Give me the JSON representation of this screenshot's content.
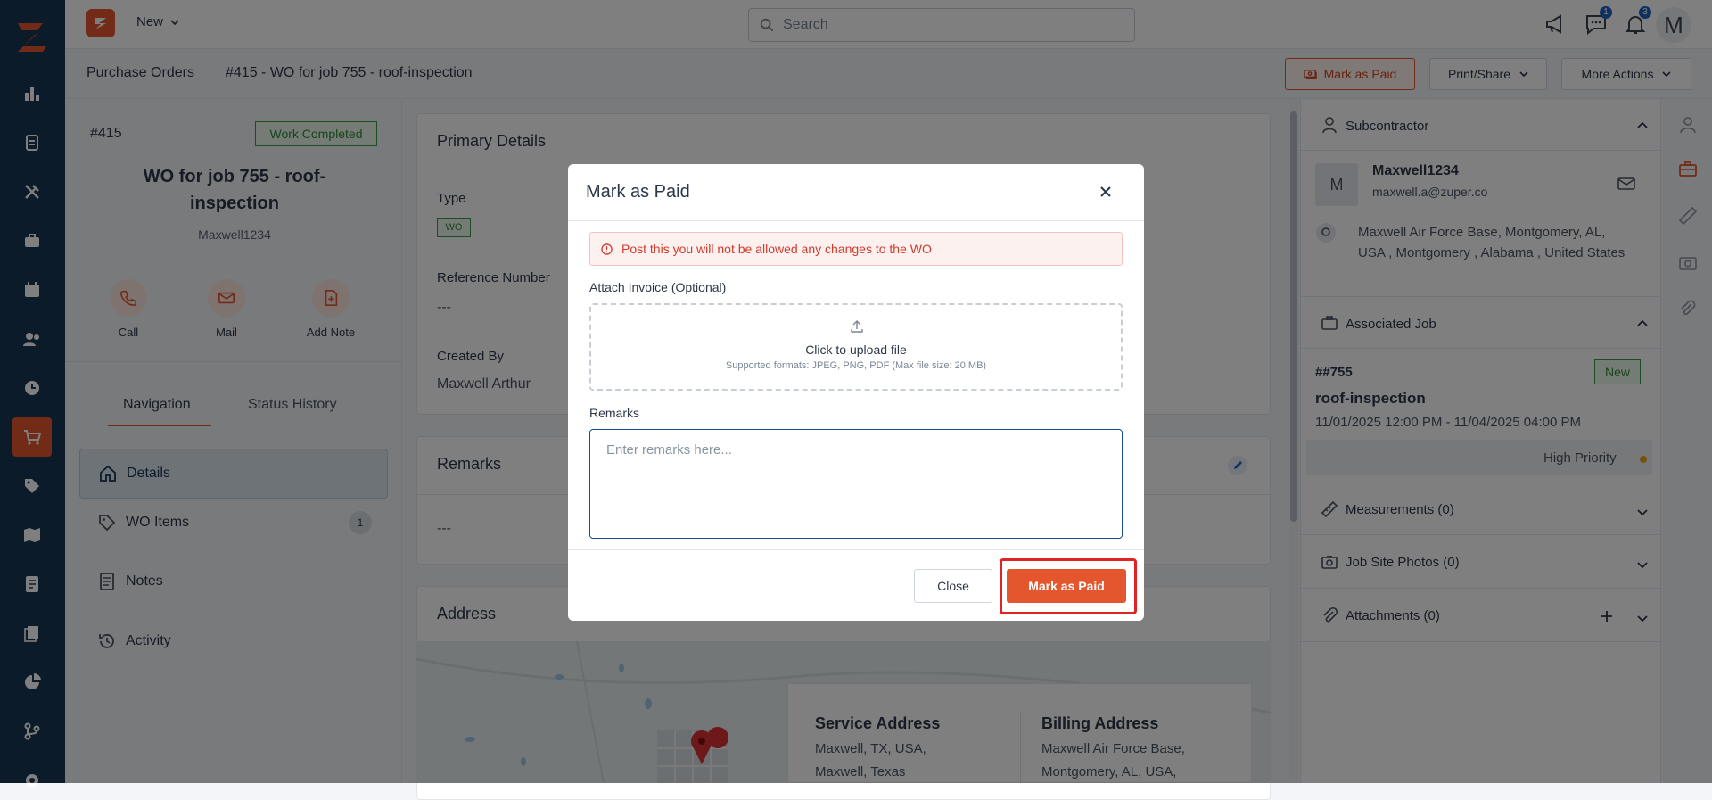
{
  "colors": {
    "brand": "#e4572e",
    "navy": "#163653",
    "success": "#2f8a3a",
    "danger": "#d23a2a"
  },
  "topbar": {
    "new_label": "New",
    "search_placeholder": "Search",
    "chat_count": "1",
    "notif_count": "3",
    "avatar_initial": "M"
  },
  "subbar": {
    "breadcrumb_root": "Purchase Orders",
    "breadcrumb_current": "#415 - WO for job 755 - roof-inspection",
    "mark_paid_label": "Mark as Paid",
    "print_share_label": "Print/Share",
    "more_actions_label": "More Actions"
  },
  "leftpanel": {
    "wo_number": "#415",
    "status": "Work Completed",
    "title": "WO for job 755 - roof-inspection",
    "subcontractor": "Maxwell1234",
    "actions": [
      {
        "label": "Call"
      },
      {
        "label": "Mail"
      },
      {
        "label": "Add Note"
      }
    ],
    "tabs": [
      {
        "label": "Navigation"
      },
      {
        "label": "Status History"
      }
    ],
    "nav": [
      {
        "label": "Details"
      },
      {
        "label": "WO Items",
        "count": "1"
      },
      {
        "label": "Notes"
      },
      {
        "label": "Activity"
      }
    ]
  },
  "main": {
    "primary_title": "Primary Details",
    "type_label": "Type",
    "type_value": "WO",
    "ref_label": "Reference Number",
    "ref_value": "---",
    "created_label": "Created By",
    "created_value": "Maxwell Arthur",
    "remarks_title": "Remarks",
    "remarks_value": "---",
    "address_title": "Address",
    "service_address_label": "Service Address",
    "service_address_lines": [
      "Maxwell, TX, USA,",
      "Maxwell, Texas"
    ],
    "billing_address_label": "Billing Address",
    "billing_address_lines": [
      "Maxwell Air Force Base,",
      "Montgomery, AL, USA,"
    ]
  },
  "rightpanel": {
    "subcontractor_title": "Subcontractor",
    "sub_initial": "M",
    "sub_name": "Maxwell1234",
    "sub_email": "maxwell.a@zuper.co",
    "sub_address": "Maxwell Air Force Base, Montgomery, AL, USA , Montgomery , Alabama , United States",
    "assoc_title": "Associated Job",
    "job_number": "##755",
    "job_status": "New",
    "job_name": "roof-inspection",
    "job_dates": "11/01/2025 12:00 PM - 11/04/2025 04:00 PM",
    "priority": "High Priority",
    "measurements": "Measurements (0)",
    "site_photos": "Job Site Photos (0)",
    "attachments": "Attachments (0)"
  },
  "modal": {
    "title": "Mark as Paid",
    "alert": "Post this you will not be allowed any changes to the WO",
    "attach_label": "Attach Invoice (Optional)",
    "upload_text": "Click to upload file",
    "upload_hint": "Supported formats: JPEG, PNG, PDF (Max file size: 20 MB)",
    "remarks_label": "Remarks",
    "remarks_placeholder": "Enter remarks here...",
    "close_label": "Close",
    "confirm_label": "Mark as Paid"
  }
}
